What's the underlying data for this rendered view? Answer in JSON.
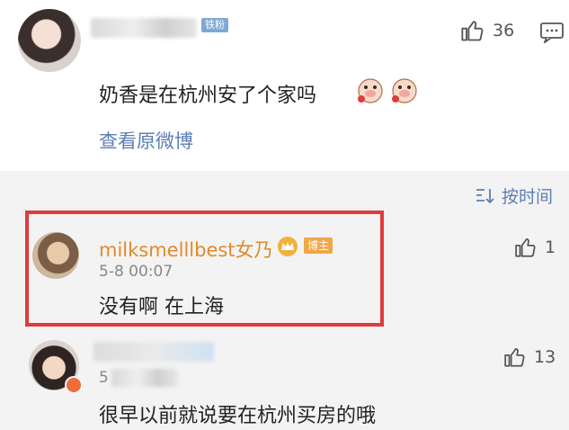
{
  "top_comment": {
    "badge": "铁粉",
    "likes": "36",
    "text": "奶香是在杭州安了个家吗",
    "view_original": "查看原微博"
  },
  "sort": {
    "label": "按时间"
  },
  "replies": [
    {
      "username": "milksmelllbest女乃",
      "badge": "博主",
      "time": "5-8 00:07",
      "text": "没有啊 在上海",
      "likes": "1"
    },
    {
      "time_partial": "5",
      "text": "很早以前就说要在杭州买房的哦",
      "likes": "13"
    }
  ],
  "colors": {
    "accent_blue": "#5b7fb4",
    "username_orange": "#e08a2b",
    "highlight_red": "#e03a3a",
    "badge_blue": "#7fa8d8",
    "badge_orange": "#f0a64a"
  }
}
